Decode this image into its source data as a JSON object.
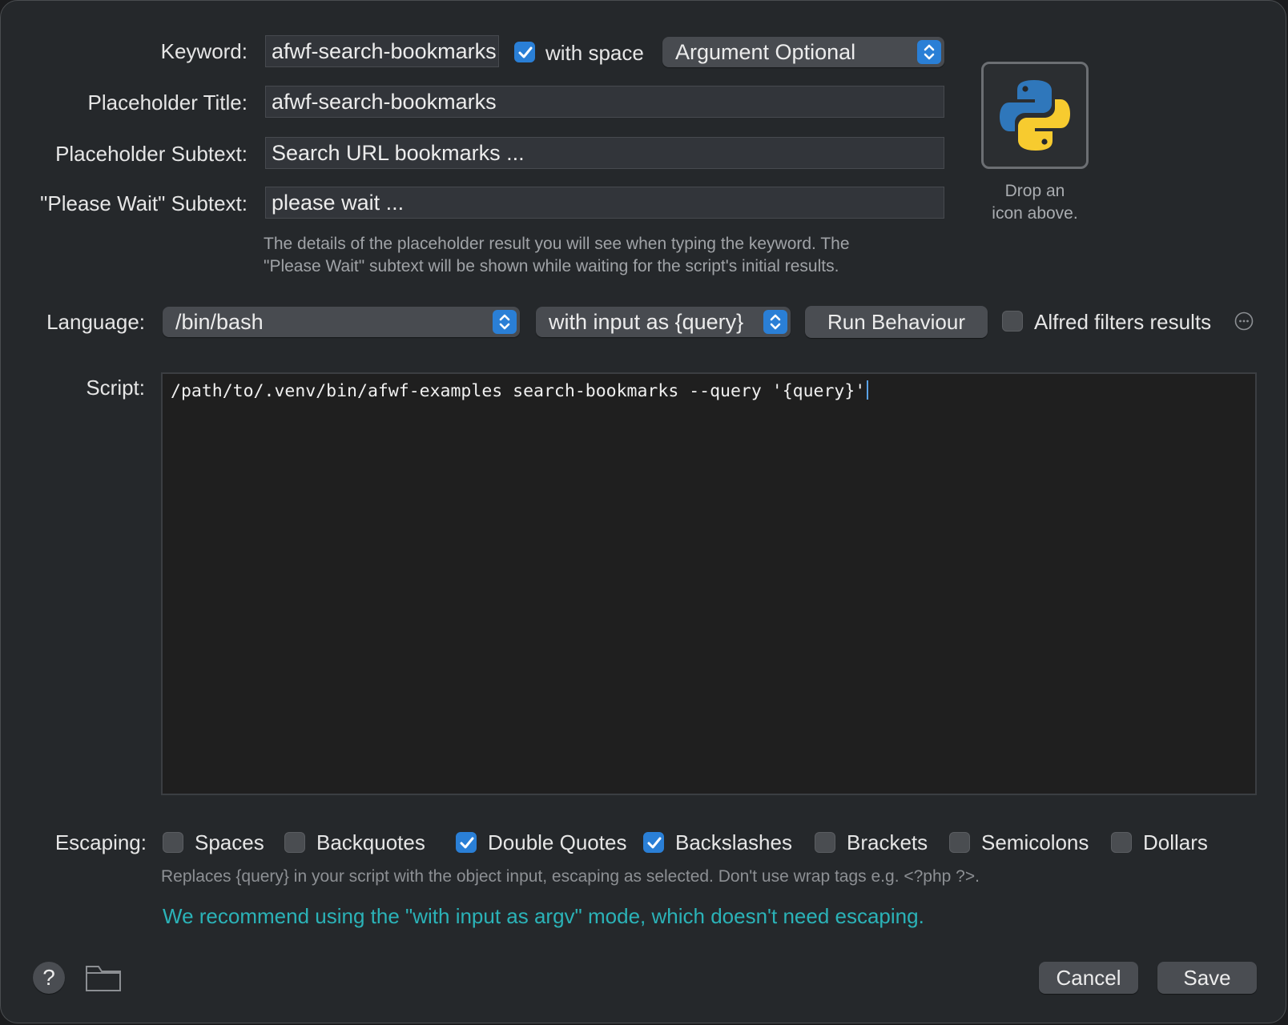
{
  "keyword": {
    "label": "Keyword:",
    "value": "afwf-search-bookmarks",
    "with_space_label": "with space",
    "with_space_checked": true,
    "argument_mode": "Argument Optional"
  },
  "placeholder_title": {
    "label": "Placeholder Title:",
    "value": "afwf-search-bookmarks"
  },
  "placeholder_subtext": {
    "label": "Placeholder Subtext:",
    "value": "Search URL bookmarks ..."
  },
  "please_wait_subtext": {
    "label": "\"Please Wait\" Subtext:",
    "value": "please wait ..."
  },
  "hint_line1": "The details of the placeholder result you will see when typing the keyword. The",
  "hint_line2": "\"Please Wait\" subtext will be shown while waiting for the script's initial results.",
  "icon_drop": {
    "line1": "Drop an",
    "line2": "icon above."
  },
  "language": {
    "label": "Language:",
    "value": "/bin/bash",
    "input_mode": "with input as {query}",
    "run_behaviour_label": "Run Behaviour",
    "alfred_filters_label": "Alfred filters results",
    "alfred_filters_checked": false
  },
  "script": {
    "label": "Script:",
    "content": "/path/to/.venv/bin/afwf-examples search-bookmarks --query '{query}'"
  },
  "escaping": {
    "label": "Escaping:",
    "options": [
      {
        "label": "Spaces",
        "checked": false
      },
      {
        "label": "Backquotes",
        "checked": false
      },
      {
        "label": "Double Quotes",
        "checked": true
      },
      {
        "label": "Backslashes",
        "checked": true
      },
      {
        "label": "Brackets",
        "checked": false
      },
      {
        "label": "Semicolons",
        "checked": false
      },
      {
        "label": "Dollars",
        "checked": false
      }
    ],
    "hint": "Replaces {query} in your script with the object input, escaping as selected. Don't use wrap tags e.g. <?php ?>.",
    "recommendation": "We recommend using the \"with input as argv\" mode, which doesn't need escaping."
  },
  "footer": {
    "help_label": "?",
    "cancel_label": "Cancel",
    "save_label": "Save"
  },
  "colors": {
    "accent": "#2a7fd6",
    "recommend": "#2bb3b8",
    "window_bg": "#25282b"
  }
}
